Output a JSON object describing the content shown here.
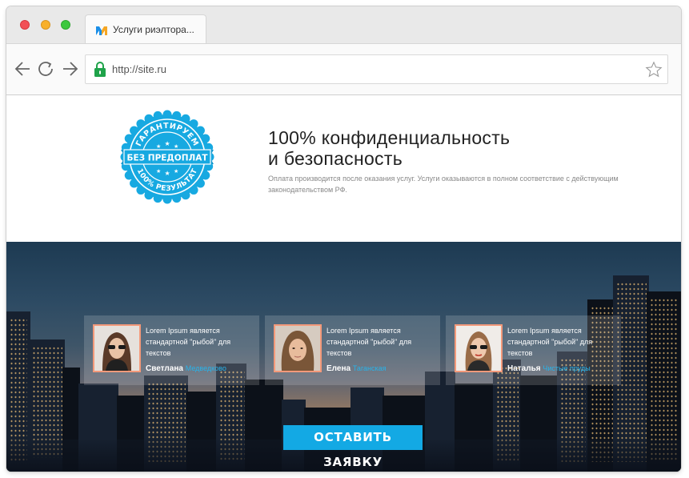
{
  "browser": {
    "tab_title": "Услуги риэлтора...",
    "url": "http://site.ru"
  },
  "seal": {
    "top_text": "ГАРАНТИРУЕМ",
    "middle_text": "БЕЗ ПРЕДОПЛАТ",
    "bottom_text": "100% РЕЗУЛЬТАТ",
    "color": "#17a9e1"
  },
  "section": {
    "headline_line1": "100% конфиденциальность",
    "headline_line2": "и безопасность",
    "description": "Оплата производится после оказания услуг. Услуги оказываются в полном соответствие с действующим законодательством РФ."
  },
  "reviews": [
    {
      "text": "Lorem Ipsum является стандартной \"рыбой\" для текстов",
      "name": "Светлана",
      "place": "Медведково"
    },
    {
      "text": "Lorem Ipsum является стандартной \"рыбой\" для текстов",
      "name": "Елена",
      "place": "Таганская"
    },
    {
      "text": "Lorem Ipsum является стандартной \"рыбой\" для текстов",
      "name": "Наталья",
      "place": "Чистые пруды"
    }
  ],
  "cta": {
    "label": "ОСТАВИТЬ ЗАЯВКУ"
  },
  "colors": {
    "accent": "#13a9e4",
    "photo_border": "#f3997a"
  }
}
